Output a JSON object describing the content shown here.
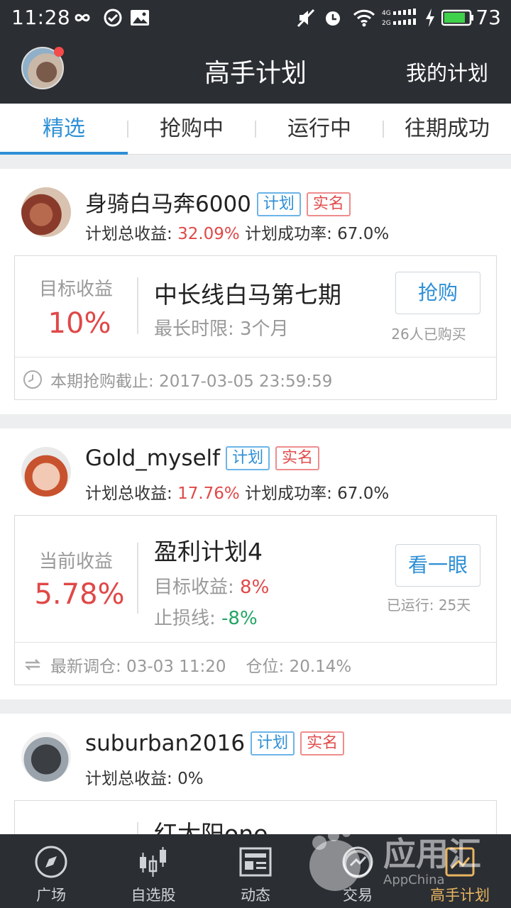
{
  "status_bar": {
    "time": "11:28",
    "battery": "73"
  },
  "header": {
    "title": "高手计划",
    "my_plan": "我的计划"
  },
  "tabs": [
    {
      "label": "精选",
      "active": true
    },
    {
      "label": "抢购中",
      "active": false
    },
    {
      "label": "运行中",
      "active": false
    },
    {
      "label": "往期成功",
      "active": false
    }
  ],
  "cards": [
    {
      "username": "身骑白马奔6000",
      "tag_plan": "计划",
      "tag_real": "实名",
      "stat_total_label": "计划总收益: ",
      "stat_total_value": "32.09%",
      "stat_rate_label": " 计划成功率: ",
      "stat_rate_value": "67.0%",
      "left_label": "目标收益",
      "left_value": "10%",
      "plan_name": "中长线白马第七期",
      "sub1": "最长时限: 3个月",
      "button": "抢购",
      "button_note": "26人已购买",
      "footer": "本期抢购截止: 2017-03-05 23:59:59"
    },
    {
      "username": "Gold_myself",
      "tag_plan": "计划",
      "tag_real": "实名",
      "stat_total_label": "计划总收益: ",
      "stat_total_value": "17.76%",
      "stat_rate_label": " 计划成功率: ",
      "stat_rate_value": "67.0%",
      "left_label": "当前收益",
      "left_value": "5.78%",
      "plan_name": "盈利计划4",
      "sub1_label": "目标收益: ",
      "sub1_value": "8%",
      "sub2_label": "止损线: ",
      "sub2_value": "-8%",
      "button": "看一眼",
      "button_note": "已运行: 25天",
      "footer": "最新调仓: 03-03 11:20",
      "footer_extra": "仓位: 20.14%"
    },
    {
      "username": "suburban2016",
      "tag_plan": "计划",
      "tag_real": "实名",
      "stat_total_label": "计划总收益: ",
      "stat_total_value": "0%",
      "plan_name": "红太阳one"
    }
  ],
  "bottom_nav": [
    {
      "label": "广场",
      "icon": "compass-icon"
    },
    {
      "label": "自选股",
      "icon": "candlestick-icon"
    },
    {
      "label": "动态",
      "icon": "news-icon"
    },
    {
      "label": "交易",
      "icon": "trade-icon"
    },
    {
      "label": "高手计划",
      "icon": "plan-icon",
      "active": true
    }
  ],
  "watermark": {
    "text": "应用汇",
    "sub": "AppChina"
  },
  "colors": {
    "accent": "#2e8fd6",
    "red": "#e04848",
    "green": "#22a563",
    "dark_bar": "#2b2e33",
    "nav_active": "#e9b560"
  }
}
